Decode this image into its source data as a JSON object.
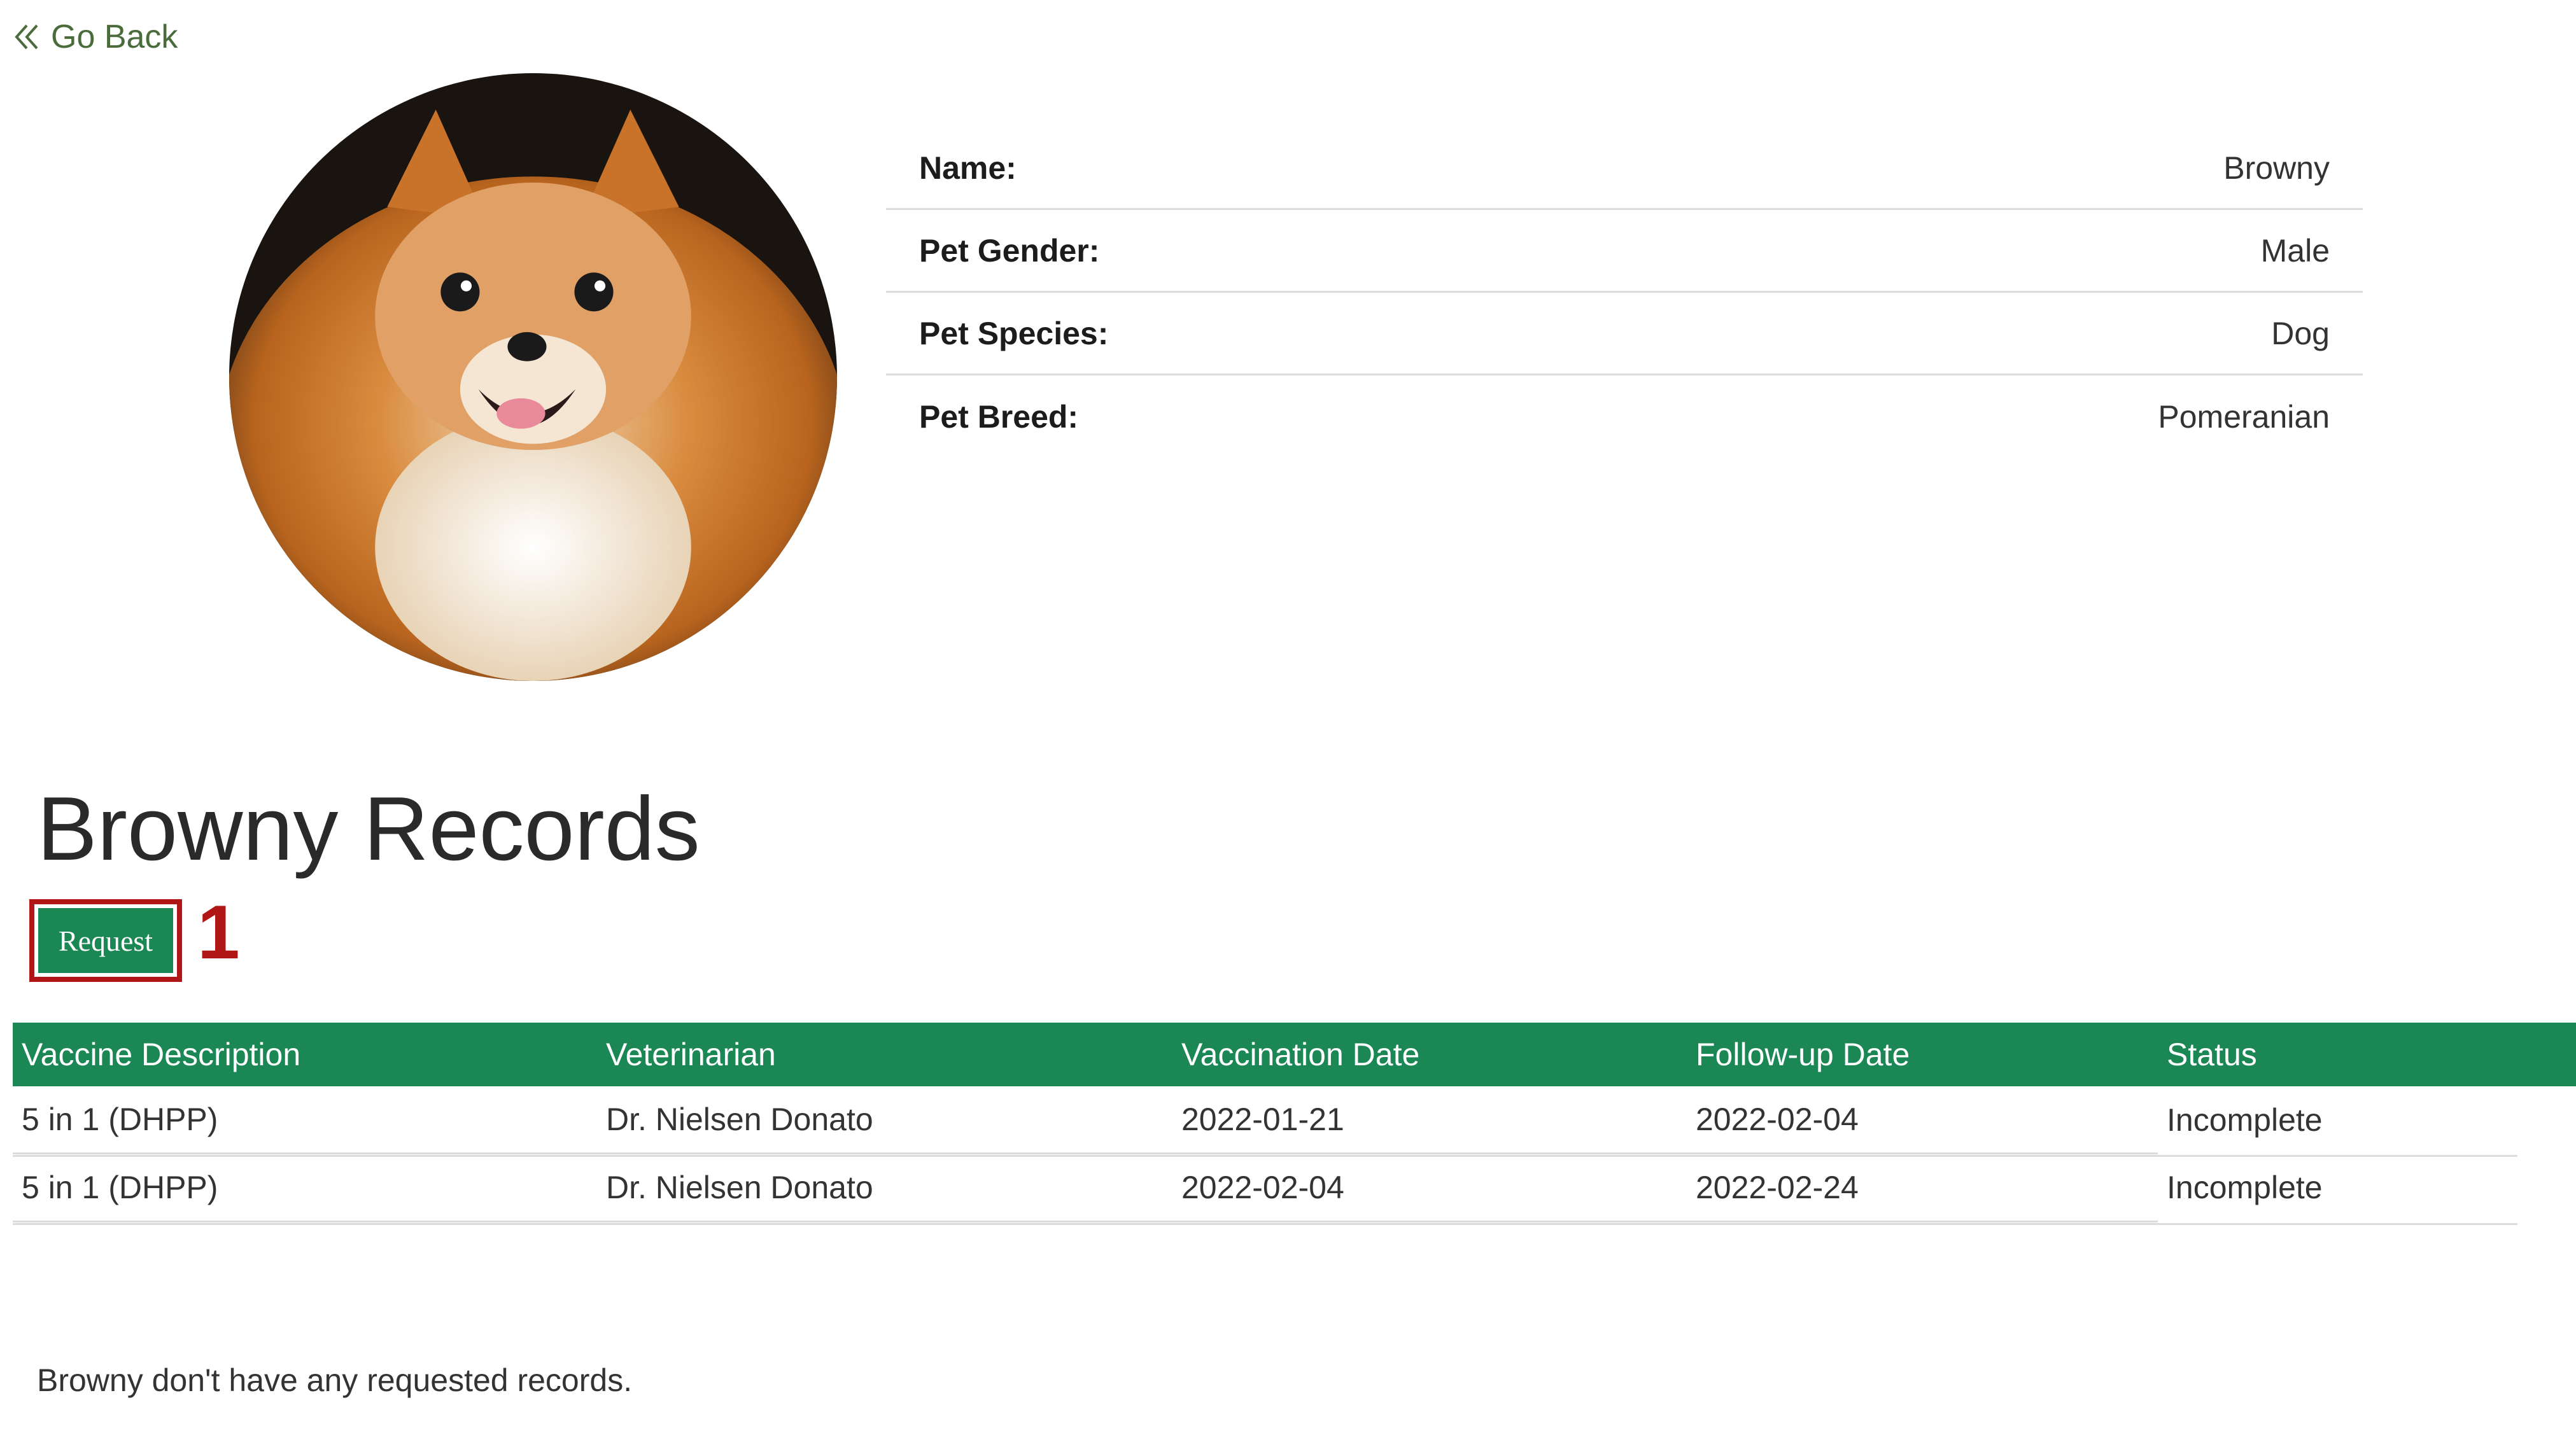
{
  "nav": {
    "back_label": "Go Back"
  },
  "pet": {
    "fields": [
      {
        "label": "Name:",
        "value": "Browny"
      },
      {
        "label": "Pet Gender:",
        "value": "Male"
      },
      {
        "label": "Pet Species:",
        "value": "Dog"
      },
      {
        "label": "Pet Breed:",
        "value": "Pomeranian"
      }
    ]
  },
  "records": {
    "title": "Browny Records",
    "request_label": "Request",
    "annotation_marker": "1",
    "columns": [
      "Vaccine Description",
      "Veterinarian",
      "Vaccination Date",
      "Follow-up Date",
      "Status"
    ],
    "rows": [
      [
        "5 in 1 (DHPP)",
        "Dr. Nielsen Donato",
        "2022-01-21",
        "2022-02-04",
        "Incomplete"
      ],
      [
        "5 in 1 (DHPP)",
        "Dr. Nielsen Donato",
        "2022-02-04",
        "2022-02-24",
        "Incomplete"
      ]
    ],
    "empty_note": "Browny don't have any requested records."
  },
  "colors": {
    "brand_green": "#1a8754",
    "annotation_red": "#b01616",
    "back_link": "#4a6b3a"
  },
  "icons": {
    "back": "double-chevron-left-icon",
    "avatar": "pomeranian-dog-photo"
  }
}
